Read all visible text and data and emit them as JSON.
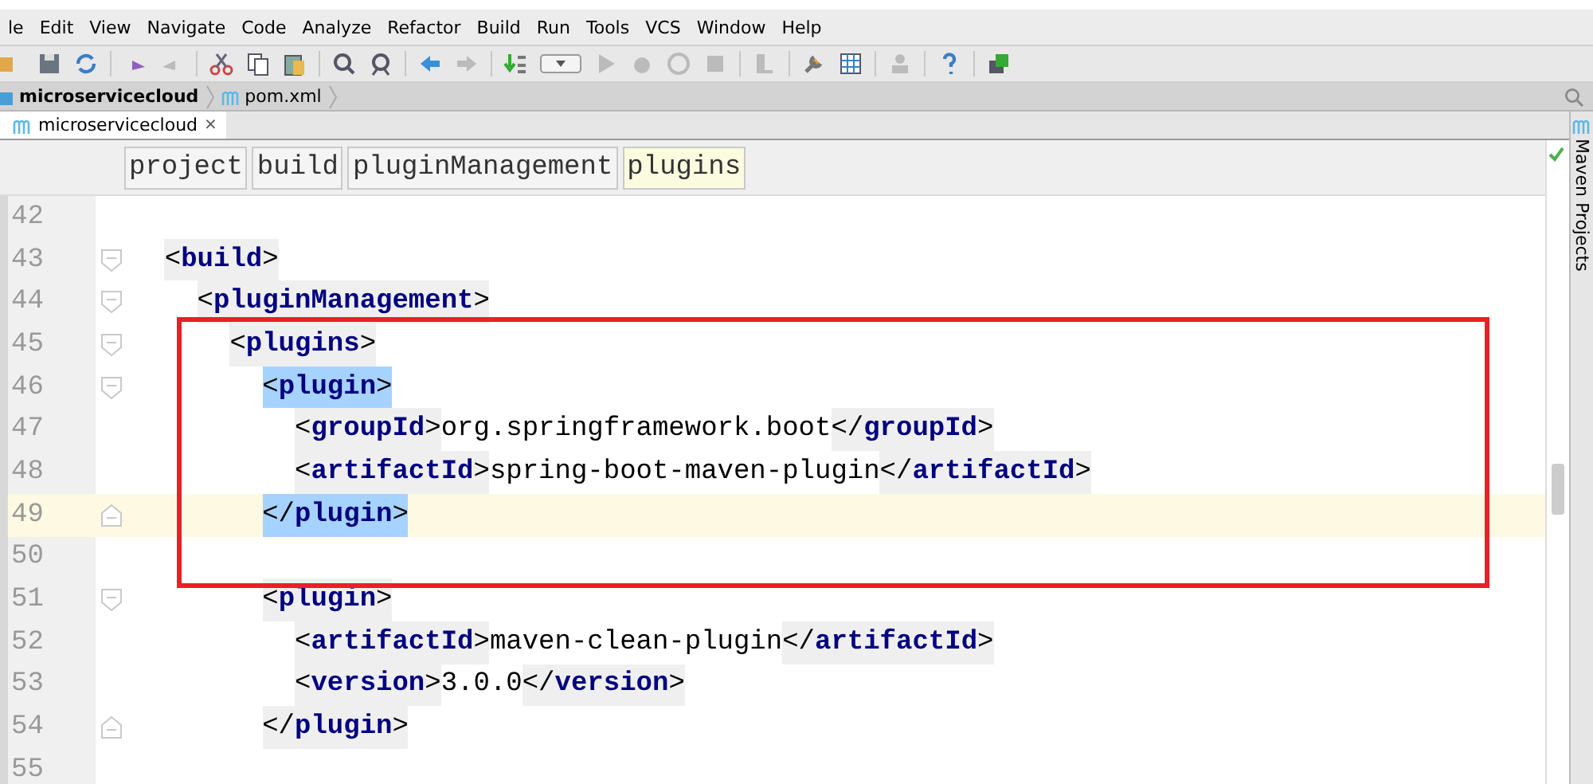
{
  "menu": [
    "le",
    "Edit",
    "View",
    "Navigate",
    "Code",
    "Analyze",
    "Refactor",
    "Build",
    "Run",
    "Tools",
    "VCS",
    "Window",
    "Help"
  ],
  "navigation_bar": {
    "project": "microservicecloud",
    "file": "pom.xml"
  },
  "tabs": [
    {
      "label": "microservicecloud",
      "selected": true,
      "close": "×"
    }
  ],
  "breadcrumbs": [
    {
      "label": "project",
      "selected": false
    },
    {
      "label": "build",
      "selected": false
    },
    {
      "label": "pluginManagement",
      "selected": false
    },
    {
      "label": "plugins",
      "selected": true
    }
  ],
  "side_panel": {
    "label": "Maven Projects"
  },
  "editor": {
    "lines": [
      {
        "number": "42",
        "current": false,
        "fold_start": false,
        "fold_end": false
      },
      {
        "number": "43",
        "current": false,
        "fold_start": true,
        "fold_end": false,
        "tokens": [
          {
            "kind": "tag",
            "text": "<build>",
            "selected": false
          }
        ],
        "children": [
          {
            "number": "44",
            "current": false,
            "fold_start": true,
            "fold_end": false,
            "tokens": [
              {
                "kind": "tag",
                "text": "<pluginManagement>",
                "selected": false
              }
            ],
            "children": [
              {
                "number": "45",
                "current": false,
                "fold_start": true,
                "fold_end": false,
                "tokens": [
                  {
                    "kind": "tag",
                    "text": "<plugins>",
                    "selected": false
                  }
                ],
                "children": [
                  {
                    "number": "46",
                    "current": false,
                    "fold_start": true,
                    "fold_end": false,
                    "tokens": [
                      {
                        "kind": "tag",
                        "text": "<plugin>",
                        "selected": true
                      }
                    ],
                    "children": [
                      {
                        "number": "47",
                        "current": false,
                        "fold_start": false,
                        "fold_end": false,
                        "tokens": [
                          {
                            "kind": "tag",
                            "text": "<groupId>",
                            "selected": false
                          },
                          {
                            "kind": "text",
                            "text": "org.springframework.boot"
                          },
                          {
                            "kind": "tag",
                            "text": "</groupId>",
                            "selected": false
                          }
                        ]
                      },
                      {
                        "number": "48",
                        "current": false,
                        "fold_start": false,
                        "fold_end": false,
                        "tokens": [
                          {
                            "kind": "tag",
                            "text": "<artifactId>",
                            "selected": false
                          },
                          {
                            "kind": "text",
                            "text": "spring-boot-maven-plugin"
                          },
                          {
                            "kind": "tag",
                            "text": "</artifactId>",
                            "selected": false
                          }
                        ]
                      }
                    ]
                  },
                  {
                    "number": "49",
                    "current": true,
                    "fold_start": false,
                    "fold_end": true,
                    "tokens": [
                      {
                        "kind": "tag",
                        "text": "</plugin>",
                        "selected": true
                      }
                    ]
                  },
                  {
                    "number": "50",
                    "current": false,
                    "fold_start": false,
                    "fold_end": false
                  },
                  {
                    "number": "51",
                    "current": false,
                    "fold_start": true,
                    "fold_end": false,
                    "tokens": [
                      {
                        "kind": "tag",
                        "text": "<plugin>",
                        "selected": false
                      }
                    ],
                    "children": [
                      {
                        "number": "52",
                        "current": false,
                        "fold_start": false,
                        "fold_end": false,
                        "tokens": [
                          {
                            "kind": "tag",
                            "text": "<artifactId>",
                            "selected": false
                          },
                          {
                            "kind": "text",
                            "text": "maven-clean-plugin"
                          },
                          {
                            "kind": "tag",
                            "text": "</artifactId>",
                            "selected": false
                          }
                        ]
                      },
                      {
                        "number": "53",
                        "current": false,
                        "fold_start": false,
                        "fold_end": false,
                        "tokens": [
                          {
                            "kind": "tag",
                            "text": "<version>",
                            "selected": false
                          },
                          {
                            "kind": "text",
                            "text": "3.0.0"
                          },
                          {
                            "kind": "tag",
                            "text": "</version>",
                            "selected": false
                          }
                        ]
                      }
                    ]
                  },
                  {
                    "number": "54",
                    "current": false,
                    "fold_start": false,
                    "fold_end": true,
                    "tokens": [
                      {
                        "kind": "tag",
                        "text": "</plugin>",
                        "selected": false
                      }
                    ]
                  }
                ]
              }
            ]
          }
        ]
      },
      {
        "number": "55",
        "current": false,
        "fold_start": false,
        "fold_end": false
      }
    ]
  }
}
